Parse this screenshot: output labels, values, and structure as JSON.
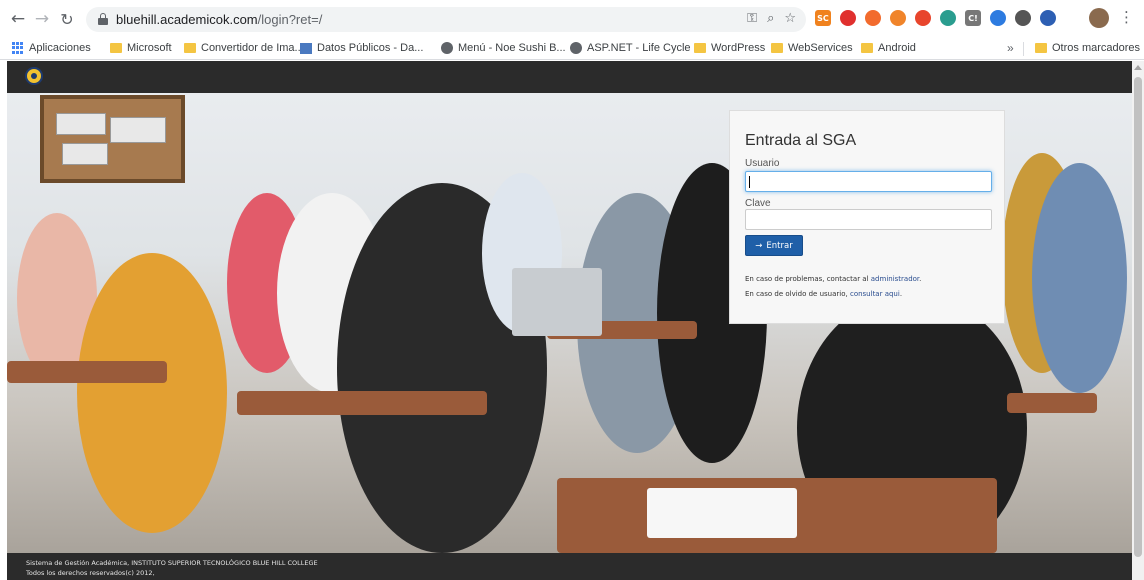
{
  "browser": {
    "url_host": "bluehill.academicok.com",
    "url_path": "/login?ret=/",
    "extensions": [
      {
        "icon": "sc-extension-icon",
        "label": "SC",
        "color": "#f0821e"
      },
      {
        "icon": "red-extension-icon",
        "label": "",
        "color": "#e0302e"
      },
      {
        "icon": "orange-extension-icon",
        "label": "",
        "color": "#f26b2d"
      },
      {
        "icon": "amber-extension-icon",
        "label": "",
        "color": "#f0842a"
      },
      {
        "icon": "redcircle-extension-icon",
        "label": "",
        "color": "#e8452c"
      },
      {
        "icon": "teal-extension-icon",
        "label": "",
        "color": "#2a9d8f"
      },
      {
        "icon": "ci-extension-icon",
        "label": "C!",
        "color": "#777777"
      },
      {
        "icon": "blue-extension-icon",
        "label": "",
        "color": "#2d7be0"
      },
      {
        "icon": "gray-extension-icon",
        "label": "",
        "color": "#555555"
      },
      {
        "icon": "navy-extension-icon",
        "label": "",
        "color": "#2d5fb3"
      }
    ]
  },
  "bookmarks": {
    "items": [
      "Aplicaciones",
      "Microsoft",
      "Convertidor de Ima...",
      "Datos Públicos - Da...",
      "Menú - Noe Sushi B...",
      "ASP.NET - Life Cycle",
      "WordPress",
      "WebServices",
      "Android"
    ],
    "overflow": "»",
    "other": "Otros marcadores"
  },
  "login": {
    "title": "Entrada al SGA",
    "user_label": "Usuario",
    "user_value": "",
    "password_label": "Clave",
    "password_value": "",
    "submit_label": "Entrar",
    "help1_prefix": "En caso de problemas, contactar al ",
    "help1_link": "administrador",
    "help1_suffix": ".",
    "help2_prefix": "En caso de olvido de usuario, ",
    "help2_link": "consultar aqui",
    "help2_suffix": "."
  },
  "footer": {
    "line1": "Sistema de Gestión Académica, INSTITUTO SUPERIOR TECNOLÓGICO BLUE HILL COLLEGE",
    "line2": "Todos los derechos reservados(c) 2012,"
  },
  "colors": {
    "header": "#2b2b2b",
    "primary_button": "#1f5fa8",
    "link": "#2a4d8f",
    "focus_border": "#66afe9"
  }
}
